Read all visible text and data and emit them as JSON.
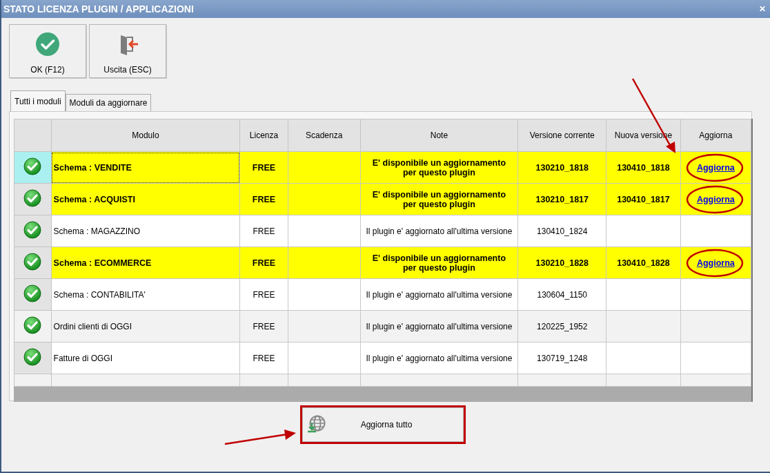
{
  "window": {
    "title": "STATO LICENZA PLUGIN / APPLICAZIONI",
    "close": "✕"
  },
  "toolbar": [
    {
      "kind": "ok",
      "label": "OK (F12)"
    },
    {
      "kind": "exit",
      "label": "Uscita (ESC)"
    }
  ],
  "tabs": [
    {
      "label": "Tutti i moduli",
      "selected": true
    },
    {
      "label": "Moduli da aggiornare",
      "selected": false
    }
  ],
  "table": {
    "columns": [
      "Modulo",
      "Licenza",
      "Scadenza",
      "Note",
      "Versione corrente",
      "Nuova versione",
      "Aggiorna"
    ],
    "rows": [
      {
        "selected": true,
        "highlighted": true,
        "circled": true,
        "modulo": "Schema : VENDITE",
        "licenza": "FREE",
        "note": "E' disponibile un aggiornamento per questo plugin",
        "versione": "130210_1818",
        "nuova": "130410_1818",
        "link": "Aggiorna"
      },
      {
        "selected": false,
        "highlighted": true,
        "circled": true,
        "modulo": "Schema : ACQUISTI",
        "licenza": "FREE",
        "note": "E' disponibile un aggiornamento per questo plugin",
        "versione": "130210_1817",
        "nuova": "130410_1817",
        "link": "Aggiorna"
      },
      {
        "selected": false,
        "highlighted": false,
        "circled": false,
        "modulo": "Schema : MAGAZZINO",
        "licenza": "FREE",
        "note": "Il plugin e' aggiornato all'ultima versione",
        "versione": "130410_1824"
      },
      {
        "selected": false,
        "highlighted": true,
        "circled": true,
        "modulo": "Schema : ECOMMERCE",
        "licenza": "FREE",
        "note": "E' disponibile un aggiornamento per questo plugin",
        "versione": "130210_1828",
        "nuova": "130410_1828",
        "link": "Aggiorna"
      },
      {
        "selected": false,
        "highlighted": false,
        "circled": false,
        "modulo": "Schema : CONTABILITA'",
        "licenza": "FREE",
        "note": "Il plugin e' aggiornato all'ultima versione",
        "versione": "130604_1150"
      },
      {
        "selected": false,
        "highlighted": false,
        "circled": false,
        "modulo": "Ordini clienti di OGGI",
        "licenza": "FREE",
        "note": "Il plugin e' aggiornato all'ultima versione",
        "versione": "120225_1952"
      },
      {
        "selected": false,
        "highlighted": false,
        "circled": false,
        "modulo": "Fatture di OGGI",
        "licenza": "FREE",
        "note": "Il plugin e' aggiornato all'ultima versione",
        "versione": "130719_1248"
      }
    ]
  },
  "update_all_button": {
    "label": "Aggiorna tutto",
    "framed": true
  }
}
